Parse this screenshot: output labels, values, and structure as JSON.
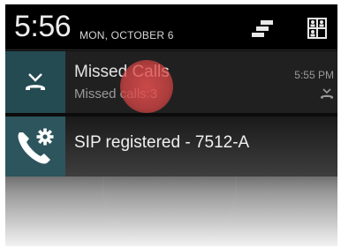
{
  "status_bar": {
    "time": "5:56",
    "date": "MON, OCTOBER 6",
    "icons": [
      "quick-settings-toggle-icon",
      "user-switcher-icon"
    ]
  },
  "notifications": [
    {
      "icon": "missed-call-icon",
      "title": "Missed Calls",
      "subtitle": "Missed calls:3",
      "time": "5:55 PM",
      "small_icon": "missed-call-small-icon"
    },
    {
      "icon": "sip-settings-phone-icon",
      "title": "SIP registered - 7512-A"
    }
  ],
  "colors": {
    "icon_box": "#244a52",
    "touch_indicator": "#e85050"
  }
}
